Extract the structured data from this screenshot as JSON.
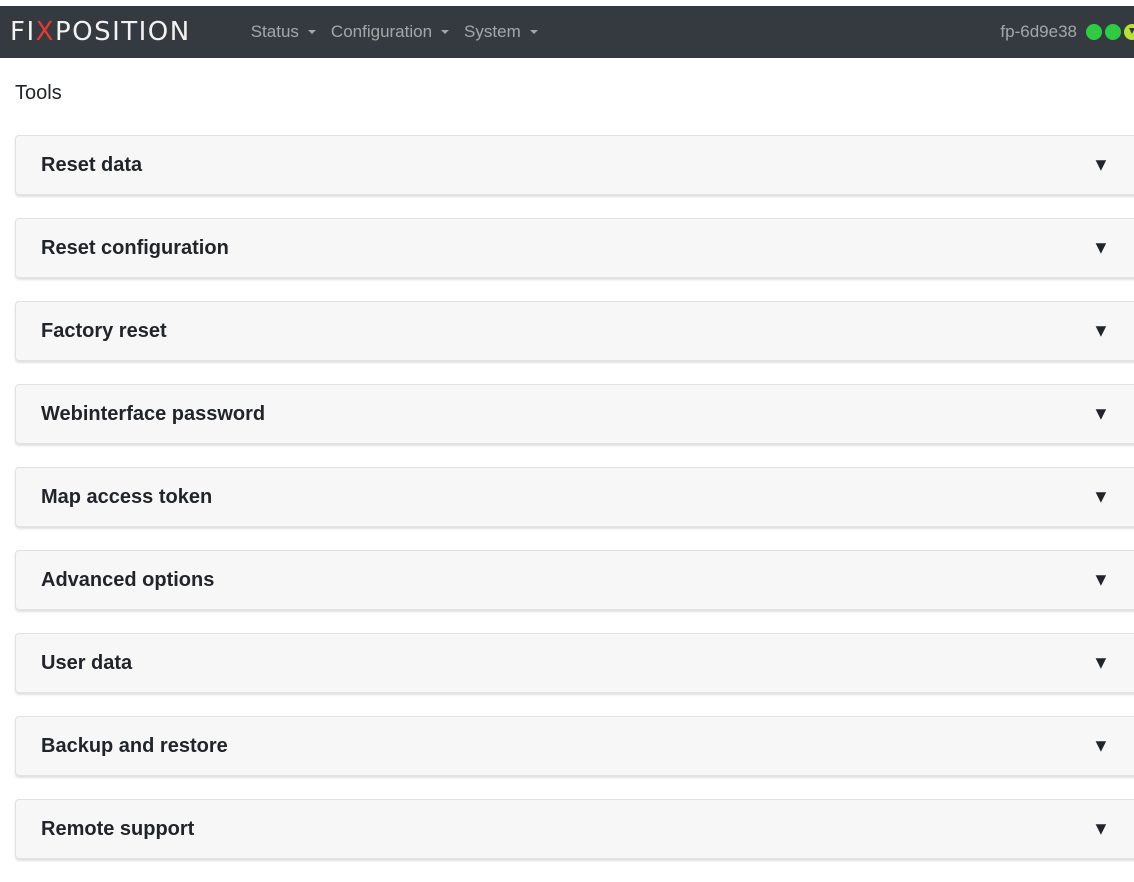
{
  "app": {
    "brand_prefix": "FI",
    "brand_x": "X",
    "brand_suffix": "POSITION"
  },
  "nav": {
    "items": [
      {
        "label": "Status"
      },
      {
        "label": "Configuration"
      },
      {
        "label": "System"
      }
    ],
    "hostname": "fp-6d9e38",
    "status_indicators": [
      {
        "color": "#2ecc40",
        "icon": "status-ok-icon"
      },
      {
        "color": "#2ecc40",
        "icon": "status-ok-icon"
      },
      {
        "color": "#b6e334",
        "icon": "status-download-icon"
      }
    ]
  },
  "page": {
    "title": "Tools"
  },
  "panels": [
    {
      "label": "Reset data",
      "toggle": "▼"
    },
    {
      "label": "Reset configuration",
      "toggle": "▼"
    },
    {
      "label": "Factory reset",
      "toggle": "▼"
    },
    {
      "label": "Webinterface password",
      "toggle": "▼"
    },
    {
      "label": "Map access token",
      "toggle": "▼"
    },
    {
      "label": "Advanced options",
      "toggle": "▼"
    },
    {
      "label": "User data",
      "toggle": "▼"
    },
    {
      "label": "Backup and restore",
      "toggle": "▼"
    },
    {
      "label": "Remote support",
      "toggle": "▼"
    }
  ]
}
